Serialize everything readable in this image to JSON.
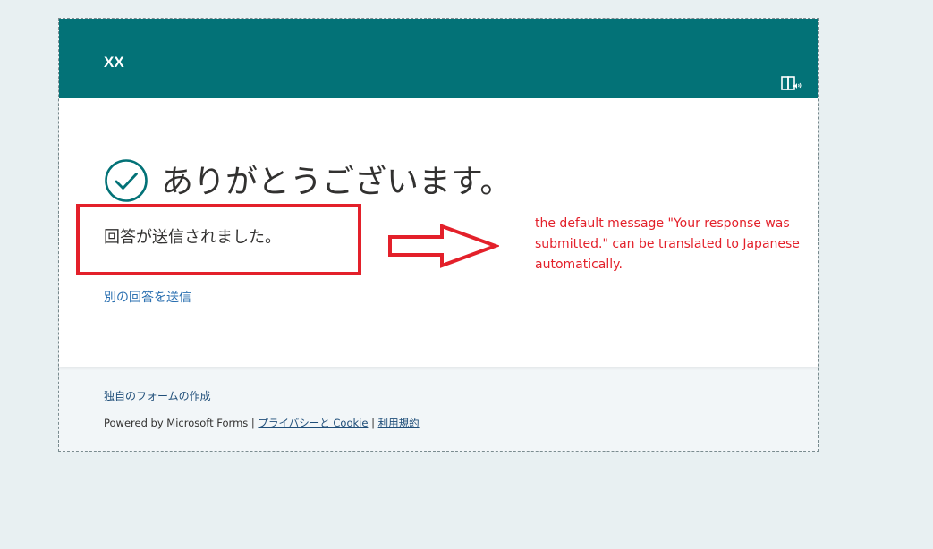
{
  "form": {
    "title": "XX",
    "thanks_message": "ありがとうございます。",
    "response_message": "回答が送信されました。",
    "another_response_link": "別の回答を送信"
  },
  "footer": {
    "create_own_form_link": "独自のフォームの作成",
    "powered_by_text": "Powered by Microsoft Forms",
    "separator": "|",
    "privacy_link": "プライバシーと Cookie",
    "terms_link": "利用規約"
  },
  "annotation": {
    "note": "the default message \"Your response was submitted.\" can be translated to Japanese automatically."
  },
  "icons": {
    "reader": "immersive-reader-icon",
    "check": "check-circle-icon"
  },
  "colors": {
    "header": "#037277",
    "accent": "#037277",
    "annotation": "#e3202a",
    "link": "#2a6fb0"
  }
}
